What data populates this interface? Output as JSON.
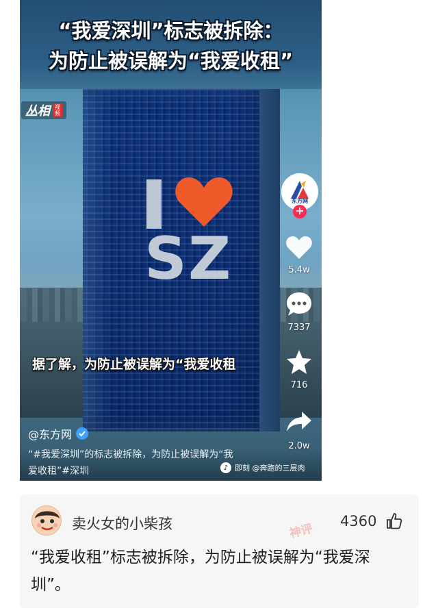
{
  "video": {
    "title_line1": "“我爱深圳”标志被拆除：",
    "title_line2": "为防止被误解为“我爱收租”",
    "source_logo": "丛相",
    "source_logo_tag": "视频",
    "sign_letter_i": "I",
    "sign_letters": "SZ",
    "subtitle": "据了解，为防止被误解为“我爱收租",
    "author_avatar_label": "东方网",
    "follow_symbol": "+",
    "likes": "5.4w",
    "comments": "7337",
    "favorites": "716",
    "shares": "2.0w",
    "handle": "@东方网",
    "description": "“#我爱深圳”的标志被拆除，为防止被误解为“我爱收租”#深圳",
    "credit": "即刻 @奔跑的三层肉",
    "credit_icon": "♪"
  },
  "comment": {
    "username": "卖火女的小柴孩",
    "like_count": "4360",
    "stamp": "神评",
    "text": "“我爱收租”标志被拆除，为防止被误解为“我爱深圳”。"
  },
  "colors": {
    "heart": "#ee5a2a",
    "follow": "#fe2c55",
    "verified": "#3ea1ff",
    "card_bg": "#f6f6f6"
  },
  "icons": [
    "heart-icon",
    "comment-bubble-icon",
    "star-icon",
    "share-arrow-icon",
    "thumbs-up-icon",
    "verified-icon"
  ]
}
